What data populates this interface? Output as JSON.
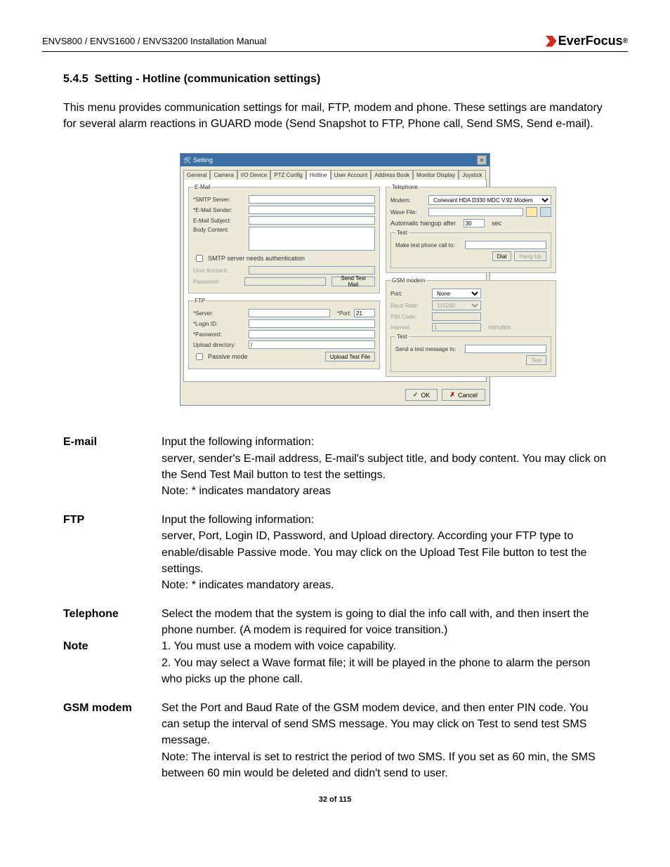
{
  "header": {
    "manual": "ENVS800 / ENVS1600 / ENVS3200 Installation Manual",
    "brand": "EverFocus"
  },
  "section": {
    "number": "5.4.5",
    "title": "Setting - Hotline  (communication settings)",
    "intro": "This menu provides communication settings for mail, FTP, modem and phone. These settings are mandatory for several alarm reactions in GUARD mode (Send Snapshot to FTP, Phone call, Send SMS, Send e-mail)."
  },
  "dialog": {
    "title": "Setting",
    "tabs": [
      "General",
      "Camera",
      "I/O Device",
      "PTZ Config",
      "Hotline",
      "User Account",
      "Address Book",
      "Monitor Display",
      "Joystick"
    ],
    "active_tab": "Hotline",
    "email": {
      "legend": "E-Mail",
      "smtp_label": "*SMTP Server:",
      "sender_label": "*E-Mail Sender:",
      "subject_label": "E-Mail Subject:",
      "body_label": "Body Content:",
      "auth_label": "SMTP server needs authentication",
      "user_label": "User Account:",
      "pass_label": "Password:",
      "send_test": "Send Test Mail"
    },
    "ftp": {
      "legend": "FTP",
      "server_label": "*Server:",
      "port_label": "*Port:",
      "port_value": "21",
      "login_label": "*Login ID:",
      "password_label": "*Password:",
      "upload_label": "Upload directory:",
      "upload_value": "/",
      "passive_label": "Passive mode",
      "upload_test": "Upload Test File"
    },
    "telephone": {
      "legend": "Telephone",
      "modem_label": "Modem:",
      "modem_value": "Conexant HDA D330 MDC V.92 Modem",
      "wave_label": "Wave File:",
      "hangup_label": "Automatic hangup after",
      "hangup_value": "30",
      "hangup_unit": "sec",
      "test_legend": "Test",
      "make_call_label": "Make test phone call to:",
      "dial": "Dial",
      "hangup": "Hang Up"
    },
    "gsm": {
      "legend": "GSM modem",
      "port_label": "Port:",
      "port_value": "None",
      "baud_label": "Baud Rate:",
      "baud_value": "115200",
      "pin_label": "PIN Code:",
      "interval_label": "Interval:",
      "interval_value": "1",
      "interval_unit": "minutes",
      "test_legend": "Test",
      "send_msg_label": "Send a test message to:",
      "test_btn": "Test"
    },
    "buttons": {
      "ok": "OK",
      "cancel": "Cancel"
    }
  },
  "defs": {
    "email_term": "E-mail",
    "email_body": "Input the following information:\n server, sender's E-mail address, E-mail's subject title, and body content. You may click on the Send Test Mail button to test the settings.\nNote: * indicates mandatory areas",
    "ftp_term": "FTP",
    "ftp_body": "Input the following information:\n server, Port, Login ID, Password, and Upload directory. According your FTP type to enable/disable Passive mode. You may click on the Upload Test File button to test the settings.\nNote: * indicates mandatory areas.",
    "tel_term": "Telephone",
    "tel_body": "Select the modem that the system is going to dial the info call with, and then insert the phone number. (A modem is required for voice transition.)",
    "note_term": "Note",
    "note_body": "1. You must use a modem with voice capability.\n2. You may select a Wave format file; it will be played in the phone to alarm the person who picks up the phone call.",
    "gsm_term": "GSM modem",
    "gsm_body": "Set the Port and Baud Rate of the GSM modem device, and then enter PIN code. You can setup the interval of send SMS message. You may click on Test to send test SMS message.\nNote: The interval is set to restrict the period of two SMS. If you set as 60 min, the SMS between 60 min would be deleted and didn't send to user."
  },
  "footer": "32 of 115"
}
